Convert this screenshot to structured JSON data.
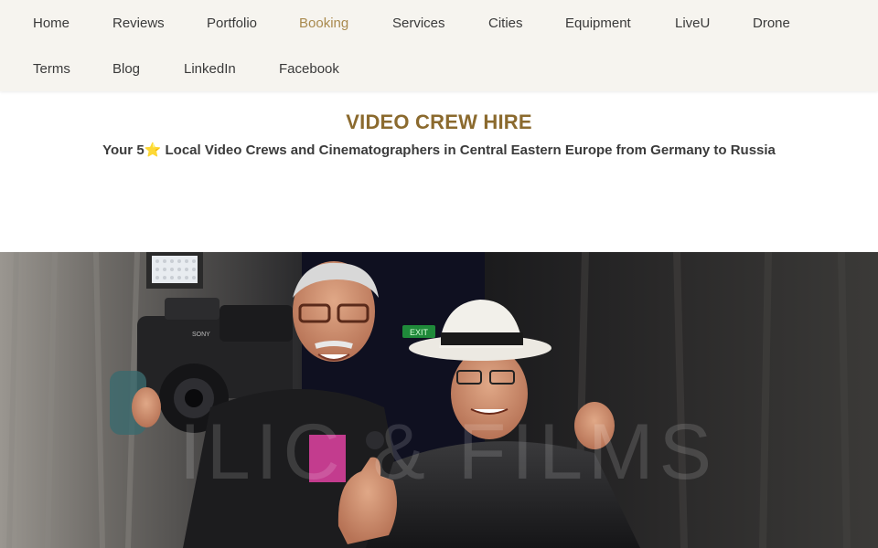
{
  "nav": {
    "items": [
      {
        "label": "Home"
      },
      {
        "label": "Reviews"
      },
      {
        "label": "Portfolio"
      },
      {
        "label": "Booking",
        "active": true
      },
      {
        "label": "Services"
      },
      {
        "label": "Cities"
      },
      {
        "label": "Equipment"
      },
      {
        "label": "LiveU"
      },
      {
        "label": "Drone"
      },
      {
        "label": "Terms"
      },
      {
        "label": "Blog"
      },
      {
        "label": "LinkedIn"
      },
      {
        "label": "Facebook"
      }
    ]
  },
  "header": {
    "title": "VIDEO CREW HIRE",
    "subtitle": "Your 5⭐ Local Video Crews and Cinematographers in Central Eastern Europe from Germany to Russia"
  },
  "hero": {
    "watermark": "ILIC & FILMS",
    "exit_sign": "EXIT",
    "camera_brand": "SONY"
  },
  "colors": {
    "nav_bg": "#f6f4ef",
    "nav_text": "#3a3a3a",
    "accent": "#a98a4e",
    "title": "#8b6a2e"
  }
}
